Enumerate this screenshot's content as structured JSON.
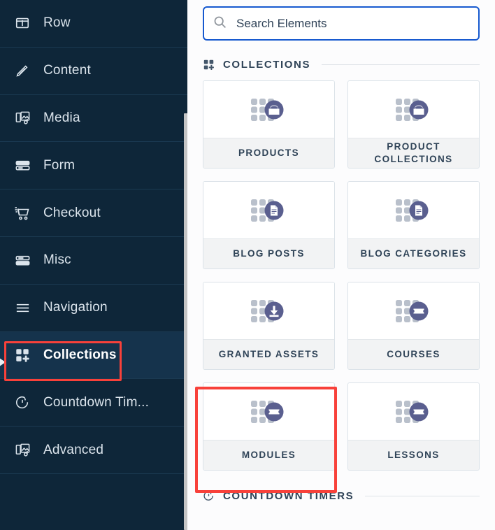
{
  "sidebar": {
    "items": [
      {
        "label": "Row",
        "icon": "row-icon",
        "active": false
      },
      {
        "label": "Content",
        "icon": "pencil-icon",
        "active": false
      },
      {
        "label": "Media",
        "icon": "media-icon",
        "active": false
      },
      {
        "label": "Form",
        "icon": "form-icon",
        "active": false
      },
      {
        "label": "Checkout",
        "icon": "cart-icon",
        "active": false
      },
      {
        "label": "Misc",
        "icon": "misc-icon",
        "active": false
      },
      {
        "label": "Navigation",
        "icon": "hamburger-icon",
        "active": false
      },
      {
        "label": "Collections",
        "icon": "collections-icon",
        "active": true
      },
      {
        "label": "Countdown Tim...",
        "icon": "clock-icon",
        "active": false
      },
      {
        "label": "Advanced",
        "icon": "media-icon",
        "active": false
      }
    ]
  },
  "search": {
    "value": "",
    "placeholder": "Search Elements",
    "icon": "search-icon",
    "border_color": "#1659cf"
  },
  "sections": [
    {
      "title": "COLLECTIONS",
      "icon": "collections-icon",
      "cards": [
        {
          "label": "PRODUCTS",
          "icon": "shopping-bag-icon",
          "highlighted": false
        },
        {
          "label": "PRODUCT COLLECTIONS",
          "icon": "shopping-bag-icon",
          "highlighted": false
        },
        {
          "label": "BLOG POSTS",
          "icon": "document-icon",
          "highlighted": false
        },
        {
          "label": "BLOG CATEGORIES",
          "icon": "document-icon",
          "highlighted": false
        },
        {
          "label": "GRANTED ASSETS",
          "icon": "download-icon",
          "highlighted": false
        },
        {
          "label": "COURSES",
          "icon": "ticket-icon",
          "highlighted": false
        },
        {
          "label": "MODULES",
          "icon": "ticket-icon",
          "highlighted": true
        },
        {
          "label": "LESSONS",
          "icon": "ticket-icon",
          "highlighted": false
        }
      ]
    },
    {
      "title": "COUNTDOWN TIMERS",
      "icon": "clock-icon",
      "cards": []
    }
  ],
  "annotations": {
    "highlight_color": "#f8413a",
    "collections_nav_highlight": "Collections",
    "modules_card_highlight": "MODULES"
  },
  "theme": {
    "sidebar_bg": "#0e2639",
    "sidebar_active_bg": "#15334c",
    "panel_bg": "#fcfcfd",
    "card_label_bg": "#f2f3f4",
    "icon_accent": "#5a5f8f",
    "text_dark": "#2f4357"
  }
}
